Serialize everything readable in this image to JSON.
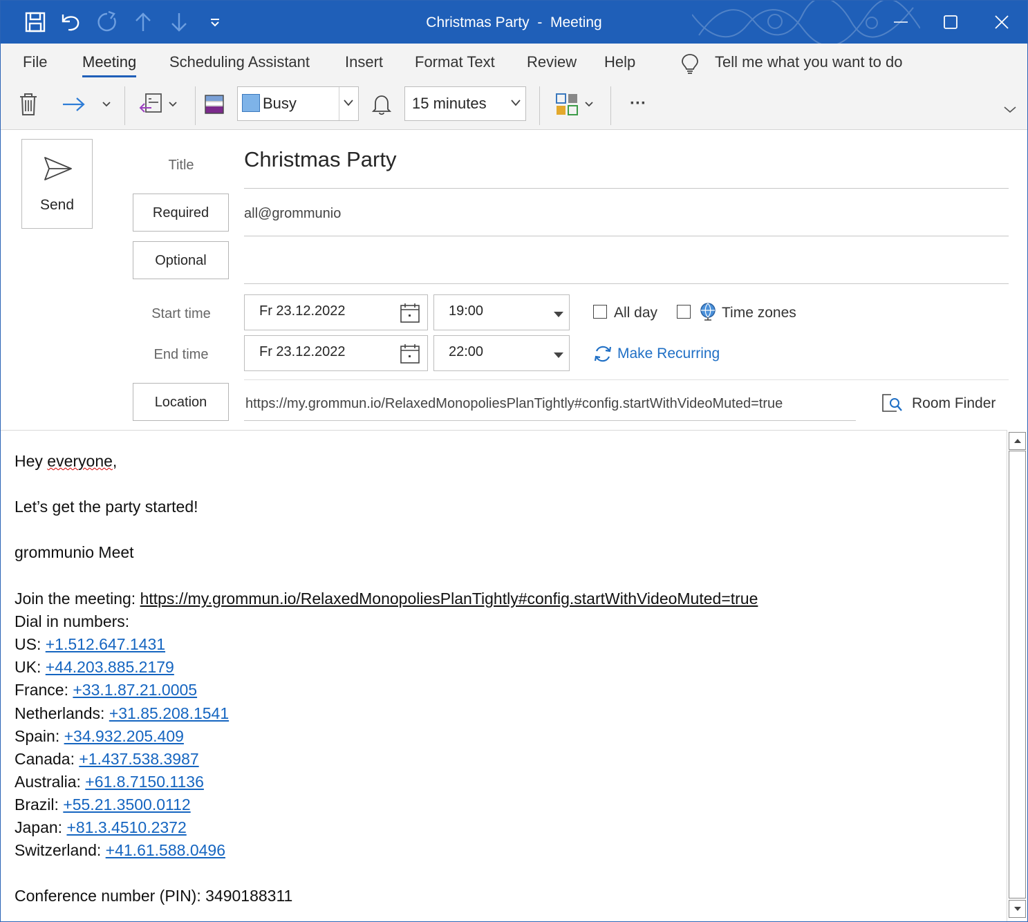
{
  "window": {
    "title": "Christmas Party",
    "separator": "-",
    "type": "Meeting"
  },
  "quick_access": [
    "save-icon",
    "undo-icon",
    "redo-icon",
    "up-icon",
    "down-icon",
    "customize-icon"
  ],
  "menu": {
    "items": [
      "File",
      "Meeting",
      "Scheduling Assistant",
      "Insert",
      "Format Text",
      "Review",
      "Help"
    ],
    "active": "Meeting",
    "tell_me": "Tell me what you want to do"
  },
  "toolbar": {
    "show_as": "Busy",
    "reminder": "15 minutes",
    "more": "···"
  },
  "form": {
    "send_label": "Send",
    "title_label": "Title",
    "title_value": "Christmas Party",
    "required_label": "Required",
    "required_value": "all@grommunio",
    "optional_label": "Optional",
    "optional_value": "",
    "start_label": "Start time",
    "start_date": "Fr 23.12.2022",
    "start_time": "19:00",
    "end_label": "End time",
    "end_date": "Fr 23.12.2022",
    "end_time": "22:00",
    "all_day_label": "All day",
    "time_zones_label": "Time zones",
    "make_recurring_label": "Make Recurring",
    "location_label": "Location",
    "location_value": "https://my.grommun.io/RelaxedMonopoliesPlanTightly#config.startWithVideoMuted=true",
    "room_finder_label": "Room Finder"
  },
  "body": {
    "greeting_1": "Hey ",
    "greeting_2": "everyone",
    "greeting_3": ",",
    "line2": "Let’s get the party started!",
    "line3": "grommunio Meet",
    "join_prefix": "Join the meeting: ",
    "join_link": "https://my.grommun.io/RelaxedMonopoliesPlanTightly#config.startWithVideoMuted=true",
    "dial_heading": "Dial in numbers:",
    "dial": [
      {
        "country": "US: ",
        "number": "+1.512.647.1431"
      },
      {
        "country": "UK: ",
        "number": "+44.203.885.2179"
      },
      {
        "country": "France: ",
        "number": "+33.1.87.21.0005"
      },
      {
        "country": "Netherlands: ",
        "number": "+31.85.208.1541"
      },
      {
        "country": "Spain: ",
        "number": "+34.932.205.409"
      },
      {
        "country": "Canada: ",
        "number": "+1.437.538.3987"
      },
      {
        "country": "Australia: ",
        "number": "+61.8.7150.1136"
      },
      {
        "country": "Brazil: ",
        "number": "+55.21.3500.0112"
      },
      {
        "country": "Japan: ",
        "number": "+81.3.4510.2372"
      },
      {
        "country": "Switzerland: ",
        "number": "+41.61.588.0496"
      }
    ],
    "pin": "Conference number (PIN): 3490188311"
  },
  "colors": {
    "titlebar": "#1f5fb8",
    "link": "#1565c0",
    "accent": "#1f5fb8"
  }
}
